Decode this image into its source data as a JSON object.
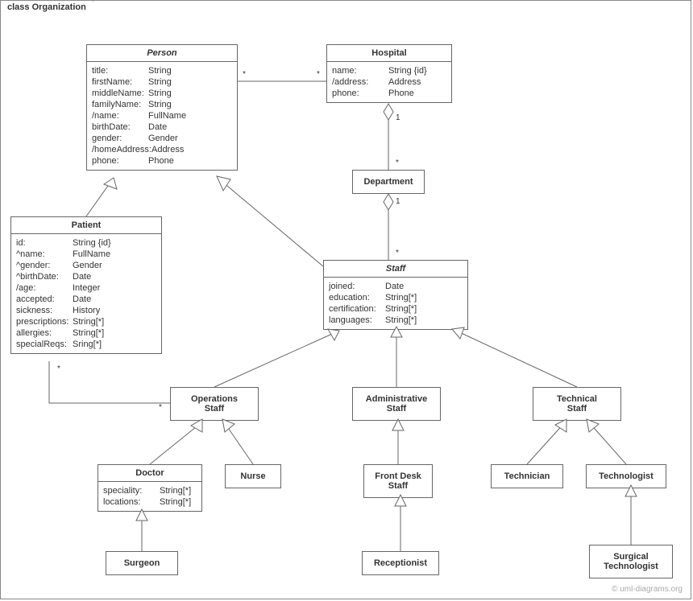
{
  "frame": {
    "title": "class Organization"
  },
  "classes": {
    "person": {
      "name": "Person",
      "attrs": [
        {
          "k": "title:",
          "v": "String"
        },
        {
          "k": "firstName:",
          "v": "String"
        },
        {
          "k": "middleName:",
          "v": "String"
        },
        {
          "k": "familyName:",
          "v": "String"
        },
        {
          "k": "/name:",
          "v": "FullName"
        },
        {
          "k": "birthDate:",
          "v": "Date"
        },
        {
          "k": "gender:",
          "v": "Gender"
        },
        {
          "k": "/homeAddress:",
          "v": "Address"
        },
        {
          "k": "phone:",
          "v": "Phone"
        }
      ]
    },
    "hospital": {
      "name": "Hospital",
      "attrs": [
        {
          "k": "name:",
          "v": "String {id}"
        },
        {
          "k": "/address:",
          "v": "Address"
        },
        {
          "k": "phone:",
          "v": "Phone"
        }
      ]
    },
    "department": {
      "name": "Department"
    },
    "patient": {
      "name": "Patient",
      "attrs": [
        {
          "k": "id:",
          "v": "String {id}"
        },
        {
          "k": "^name:",
          "v": "FullName"
        },
        {
          "k": "^gender:",
          "v": "Gender"
        },
        {
          "k": "^birthDate:",
          "v": "Date"
        },
        {
          "k": "/age:",
          "v": "Integer"
        },
        {
          "k": "accepted:",
          "v": "Date"
        },
        {
          "k": "sickness:",
          "v": "History"
        },
        {
          "k": "prescriptions:",
          "v": "String[*]"
        },
        {
          "k": "allergies:",
          "v": "String[*]"
        },
        {
          "k": "specialReqs:",
          "v": "Sring[*]"
        }
      ]
    },
    "staff": {
      "name": "Staff",
      "attrs": [
        {
          "k": "joined:",
          "v": "Date"
        },
        {
          "k": "education:",
          "v": "String[*]"
        },
        {
          "k": "certification:",
          "v": "String[*]"
        },
        {
          "k": "languages:",
          "v": "String[*]"
        }
      ]
    },
    "opsStaff": {
      "name1": "Operations",
      "name2": "Staff"
    },
    "adminStaff": {
      "name1": "Administrative",
      "name2": "Staff"
    },
    "techStaff": {
      "name1": "Technical",
      "name2": "Staff"
    },
    "doctor": {
      "name": "Doctor",
      "attrs": [
        {
          "k": "speciality:",
          "v": "String[*]"
        },
        {
          "k": "locations:",
          "v": "String[*]"
        }
      ]
    },
    "nurse": {
      "name": "Nurse"
    },
    "frontDesk": {
      "name1": "Front Desk",
      "name2": "Staff"
    },
    "technician": {
      "name": "Technician"
    },
    "technologist": {
      "name": "Technologist"
    },
    "surgeon": {
      "name": "Surgeon"
    },
    "receptionist": {
      "name": "Receptionist"
    },
    "surgTech": {
      "name1": "Surgical",
      "name2": "Technologist"
    }
  },
  "mult": {
    "personHospL": "*",
    "personHospR": "*",
    "hospDeptTop": "1",
    "hospDeptBot": "*",
    "deptStaffTop": "1",
    "deptStaffBot": "*",
    "patientOpsL": "*",
    "patientOpsR": "*"
  },
  "watermark": "© uml-diagrams.org"
}
